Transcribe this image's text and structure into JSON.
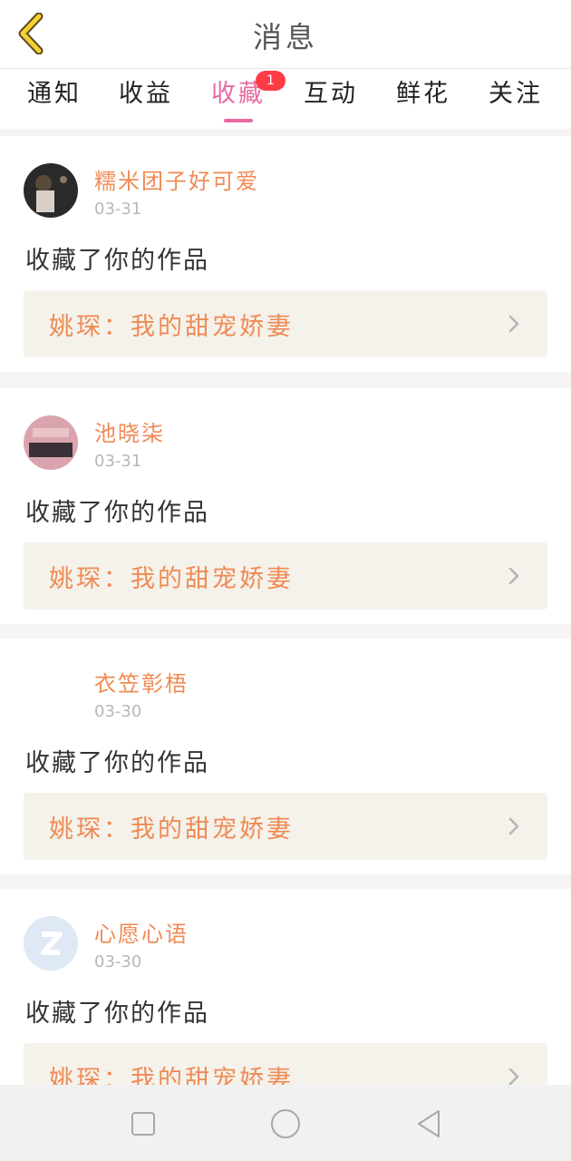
{
  "header": {
    "title": "消息"
  },
  "tabs": [
    {
      "label": "通知"
    },
    {
      "label": "收益"
    },
    {
      "label": "收藏",
      "badge": "1"
    },
    {
      "label": "互动"
    },
    {
      "label": "鲜花"
    },
    {
      "label": "关注"
    }
  ],
  "messages": [
    {
      "user": "糯米团子好可爱",
      "date": "03-31",
      "action": "收藏了你的作品",
      "work": "姚琛：我的甜宠娇妻"
    },
    {
      "user": "池晓柒",
      "date": "03-31",
      "action": "收藏了你的作品",
      "work": "姚琛：我的甜宠娇妻"
    },
    {
      "user": "衣笠彰梧",
      "date": "03-30",
      "action": "收藏了你的作品",
      "work": "姚琛：我的甜宠娇妻"
    },
    {
      "user": "心愿心语",
      "date": "03-30",
      "action": "收藏了你的作品",
      "work": "姚琛：我的甜宠娇妻"
    }
  ],
  "colors": {
    "accent": "#e86aa2",
    "name": "#f08a55",
    "badge": "#ff3b45"
  },
  "icons": {
    "back": "chevron-left-icon",
    "more": "chevron-right-icon"
  }
}
